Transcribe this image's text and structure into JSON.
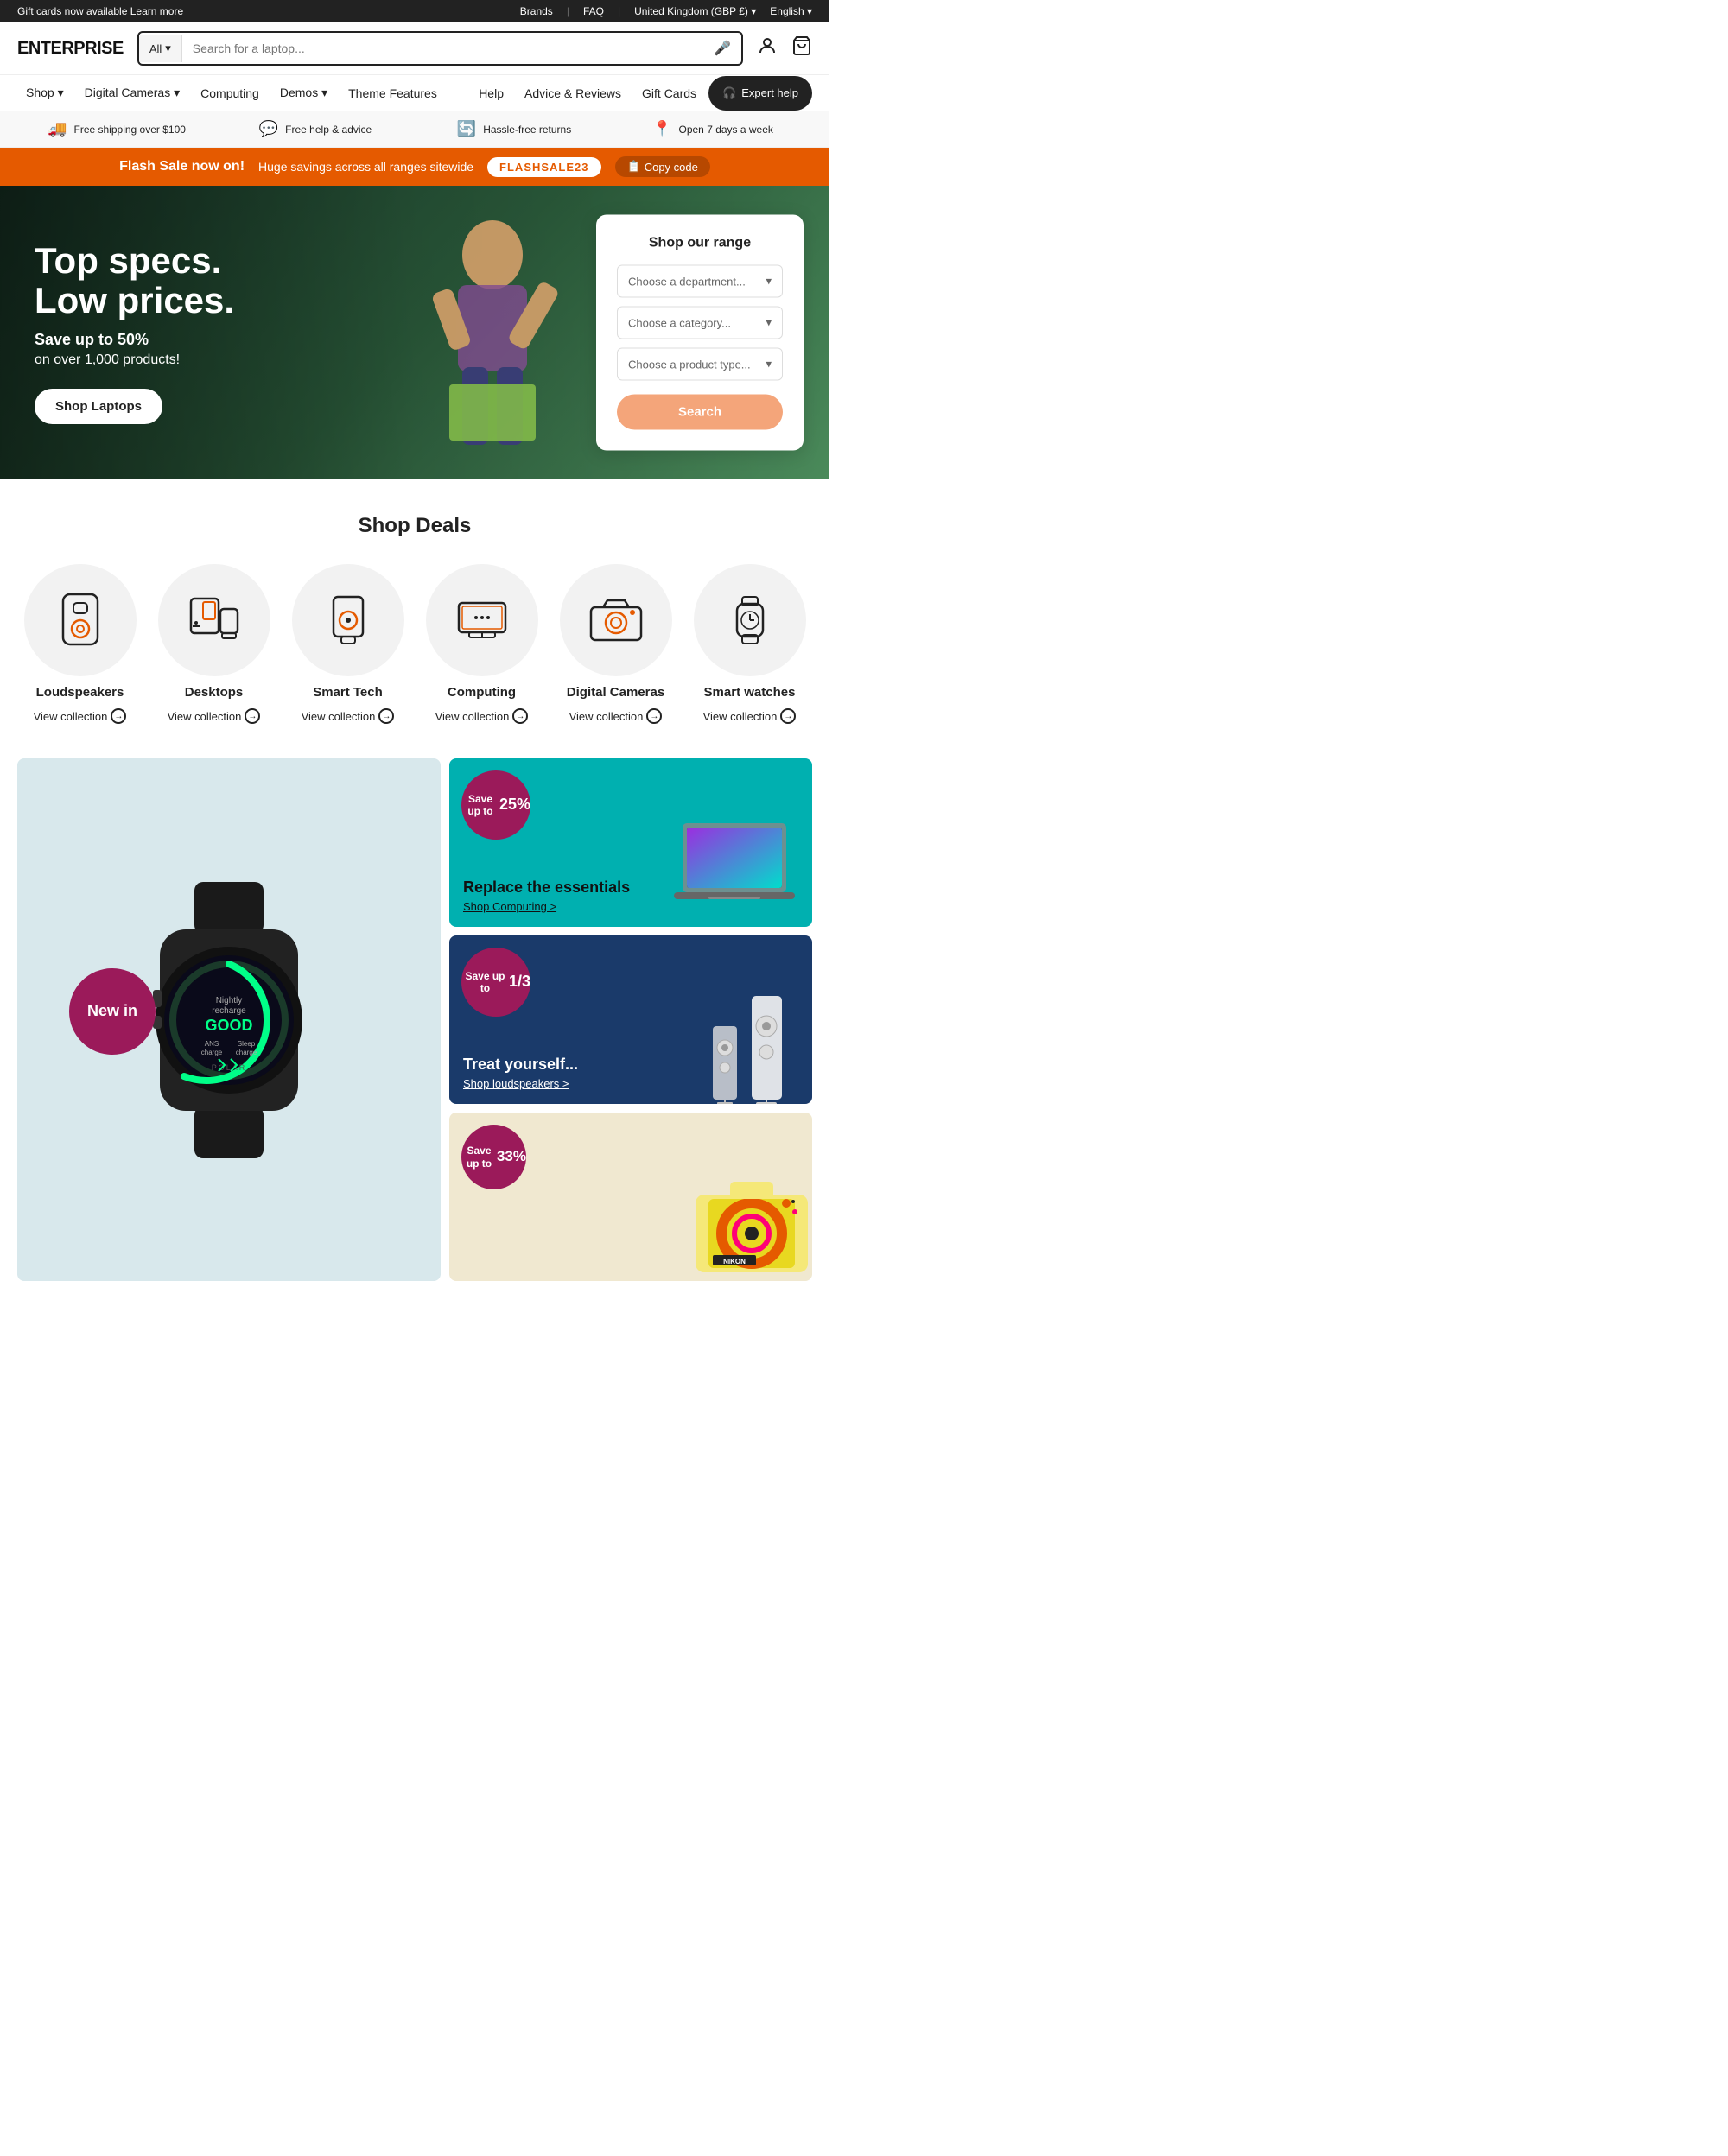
{
  "topbar": {
    "left_text": "Gift cards now available",
    "left_link": "Learn more",
    "right_items": [
      {
        "label": "Brands"
      },
      {
        "label": "FAQ"
      },
      {
        "label": "United Kingdom (GBP £)"
      },
      {
        "label": "English"
      }
    ]
  },
  "header": {
    "logo": "ENTERPRISE",
    "search": {
      "category": "All",
      "placeholder": "Search for a laptop..."
    }
  },
  "nav": {
    "left_items": [
      {
        "label": "Shop",
        "has_arrow": true
      },
      {
        "label": "Digital Cameras",
        "has_arrow": true
      },
      {
        "label": "Computing",
        "has_arrow": false
      },
      {
        "label": "Demos",
        "has_arrow": true
      },
      {
        "label": "Theme Features",
        "has_arrow": false
      }
    ],
    "right_items": [
      {
        "label": "Help"
      },
      {
        "label": "Advice & Reviews"
      },
      {
        "label": "Gift Cards"
      },
      {
        "label": "Expert help"
      }
    ]
  },
  "benefits": [
    {
      "icon": "🚚",
      "text": "Free shipping over $100"
    },
    {
      "icon": "💬",
      "text": "Free help & advice"
    },
    {
      "icon": "🔄",
      "text": "Hassle-free returns"
    },
    {
      "icon": "📍",
      "text": "Open 7 days a week"
    }
  ],
  "flash_sale": {
    "title": "Flash Sale now on!",
    "text": "Huge savings across all ranges sitewide",
    "code": "FLASHSALE23",
    "copy_label": "Copy code"
  },
  "hero": {
    "title_line1": "Top specs.",
    "title_line2": "Low prices.",
    "subtitle": "Save up to 50%",
    "sub2": "on over 1,000 products!",
    "cta": "Shop Laptops",
    "shop_range": {
      "title": "Shop our range",
      "dept_placeholder": "Choose a department...",
      "cat_placeholder": "Choose a category...",
      "type_placeholder": "Choose a product type...",
      "search_label": "Search"
    }
  },
  "deals": {
    "title": "Shop Deals",
    "items": [
      {
        "name": "Loudspeakers",
        "link": "View collection",
        "icon": "🔊"
      },
      {
        "name": "Desktops",
        "link": "View collection",
        "icon": "🖥️"
      },
      {
        "name": "Smart Tech",
        "link": "View collection",
        "icon": "📸"
      },
      {
        "name": "Computing",
        "link": "View collection",
        "icon": "💻"
      },
      {
        "name": "Digital Cameras",
        "link": "View collection",
        "icon": "📷"
      },
      {
        "name": "Smart watches",
        "link": "View collection",
        "icon": "⌚"
      }
    ]
  },
  "promos": {
    "large": {
      "badge": "New in"
    },
    "items": [
      {
        "badge_text": "Save up to\n25%",
        "title": "Replace the essentials",
        "link": "Shop Computing >"
      },
      {
        "badge_text": "Save up to\n1/3",
        "title": "Treat yourself...",
        "link": "Shop loudspeakers >"
      },
      {
        "badge_text": "Save up to\n33%",
        "title": "",
        "link": ""
      }
    ]
  }
}
